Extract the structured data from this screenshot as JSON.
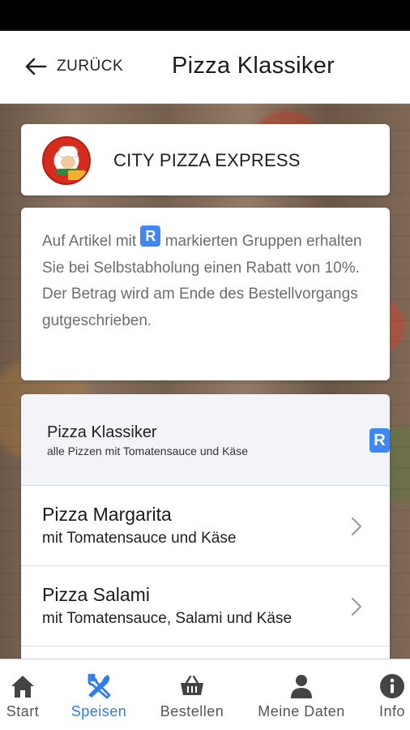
{
  "header": {
    "back_label": "ZURÜCK",
    "title": "Pizza Klassiker"
  },
  "shop": {
    "name": "CITY PIZZA EXPRESS"
  },
  "info": {
    "text_before_badge": "Auf Artikel mit ",
    "badge": "R",
    "text_after_badge": " markierten Gruppen erhalten Sie bei Selbstabholung einen Rabatt von 10%. Der Betrag wird am Ende des Bestellvorgangs gutgeschrieben."
  },
  "group": {
    "title": "Pizza Klassiker",
    "subtitle": "alle Pizzen mit Tomatensauce und Käse",
    "badge": "R"
  },
  "items": [
    {
      "name": "Pizza Margarita",
      "description": "mit Tomatensauce und Käse"
    },
    {
      "name": "Pizza Salami",
      "description": "mit Tomatensauce, Salami und Käse"
    }
  ],
  "tabbar": {
    "tabs": [
      {
        "label": "Start",
        "icon": "home-icon"
      },
      {
        "label": "Speisen",
        "icon": "utensils-icon",
        "active": true
      },
      {
        "label": "Bestellen",
        "icon": "basket-icon"
      },
      {
        "label": "Meine Daten",
        "icon": "user-icon"
      },
      {
        "label": "Info",
        "icon": "info-icon"
      }
    ]
  },
  "colors": {
    "accent": "#2f7bf2",
    "badge": "#3f88f2",
    "group_header_bg": "#f2f4f8"
  }
}
